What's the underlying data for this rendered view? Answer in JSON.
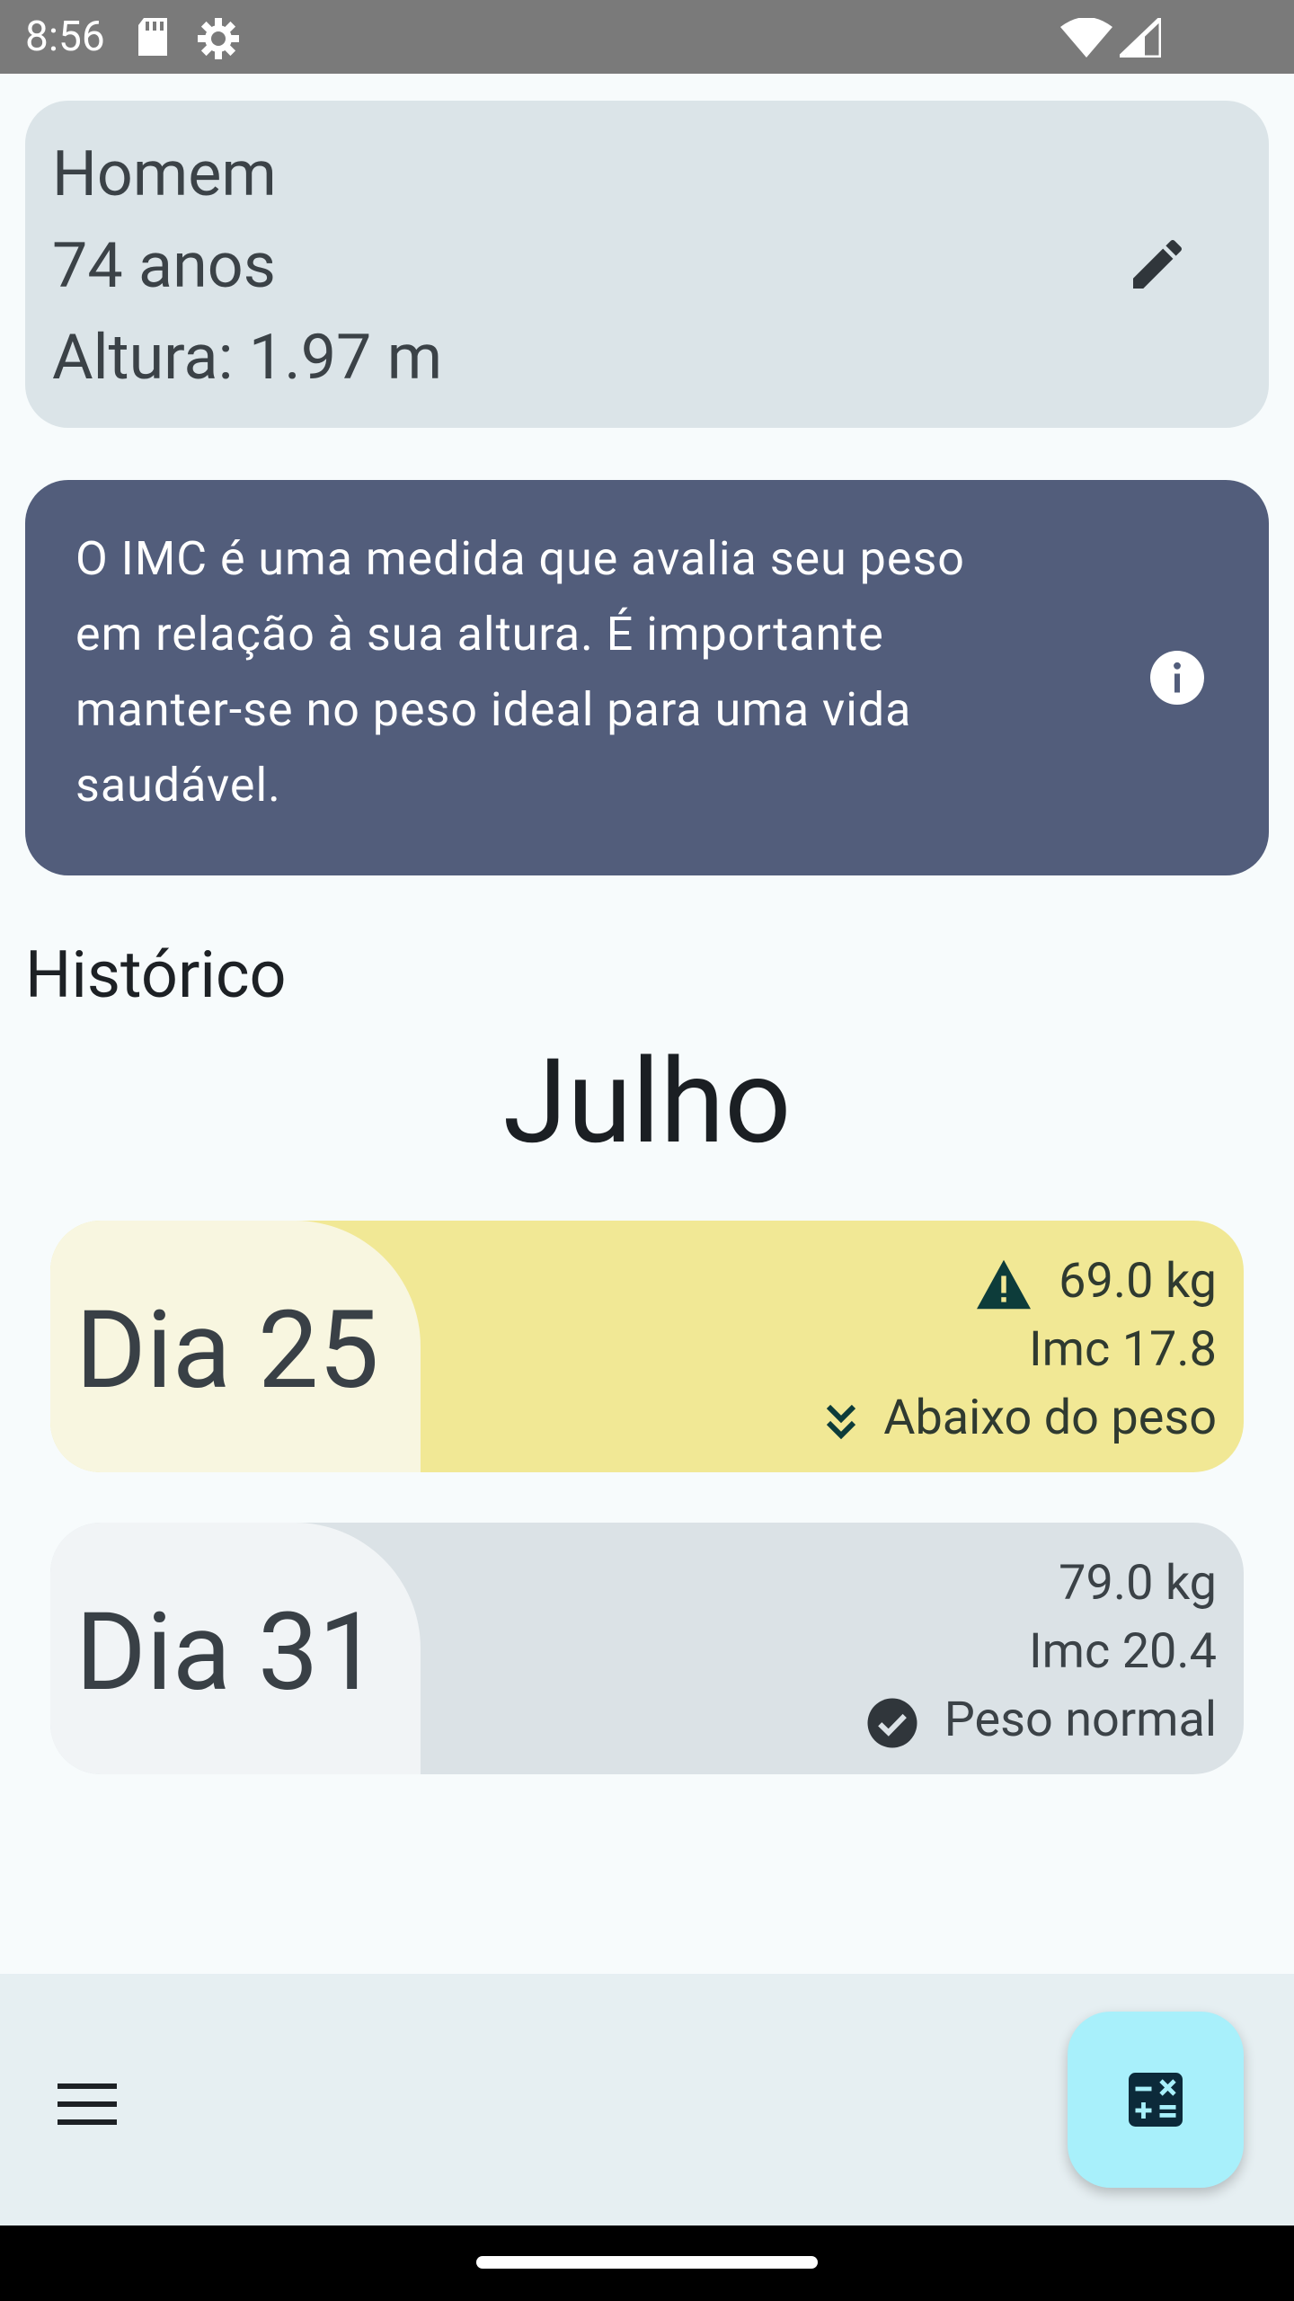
{
  "status_bar": {
    "time": "8:56",
    "icons": [
      "sd-card-icon",
      "settings-gear-icon",
      "wifi-icon",
      "signal-icon"
    ]
  },
  "profile": {
    "sex": "Homem",
    "age": "74 anos",
    "height": "Altura: 1.97 m",
    "edit_icon": "pencil-icon"
  },
  "info": {
    "text": "O IMC é uma medida que avalia seu peso em relação à sua altura. É importante manter-se no peso ideal para uma vida saudável.",
    "icon": "info-icon"
  },
  "history": {
    "title": "Histórico",
    "month": "Julho",
    "entries": [
      {
        "day": "Dia 25",
        "weight": "69.0 kg",
        "imc": "Imc 17.8",
        "status": "Abaixo do peso",
        "status_icon": "double-chevron-down-icon",
        "warning_icon": "warning-triangle-icon",
        "color": "#f1e895"
      },
      {
        "day": "Dia 31",
        "weight": "79.0 kg",
        "imc": "Imc 20.4",
        "status": "Peso normal",
        "status_icon": "check-circle-icon",
        "color": "#dbe2e6"
      }
    ]
  },
  "bottom_bar": {
    "menu_icon": "hamburger-menu-icon",
    "fab_icon": "calculator-icon",
    "fab_color": "#a8f0fb"
  }
}
